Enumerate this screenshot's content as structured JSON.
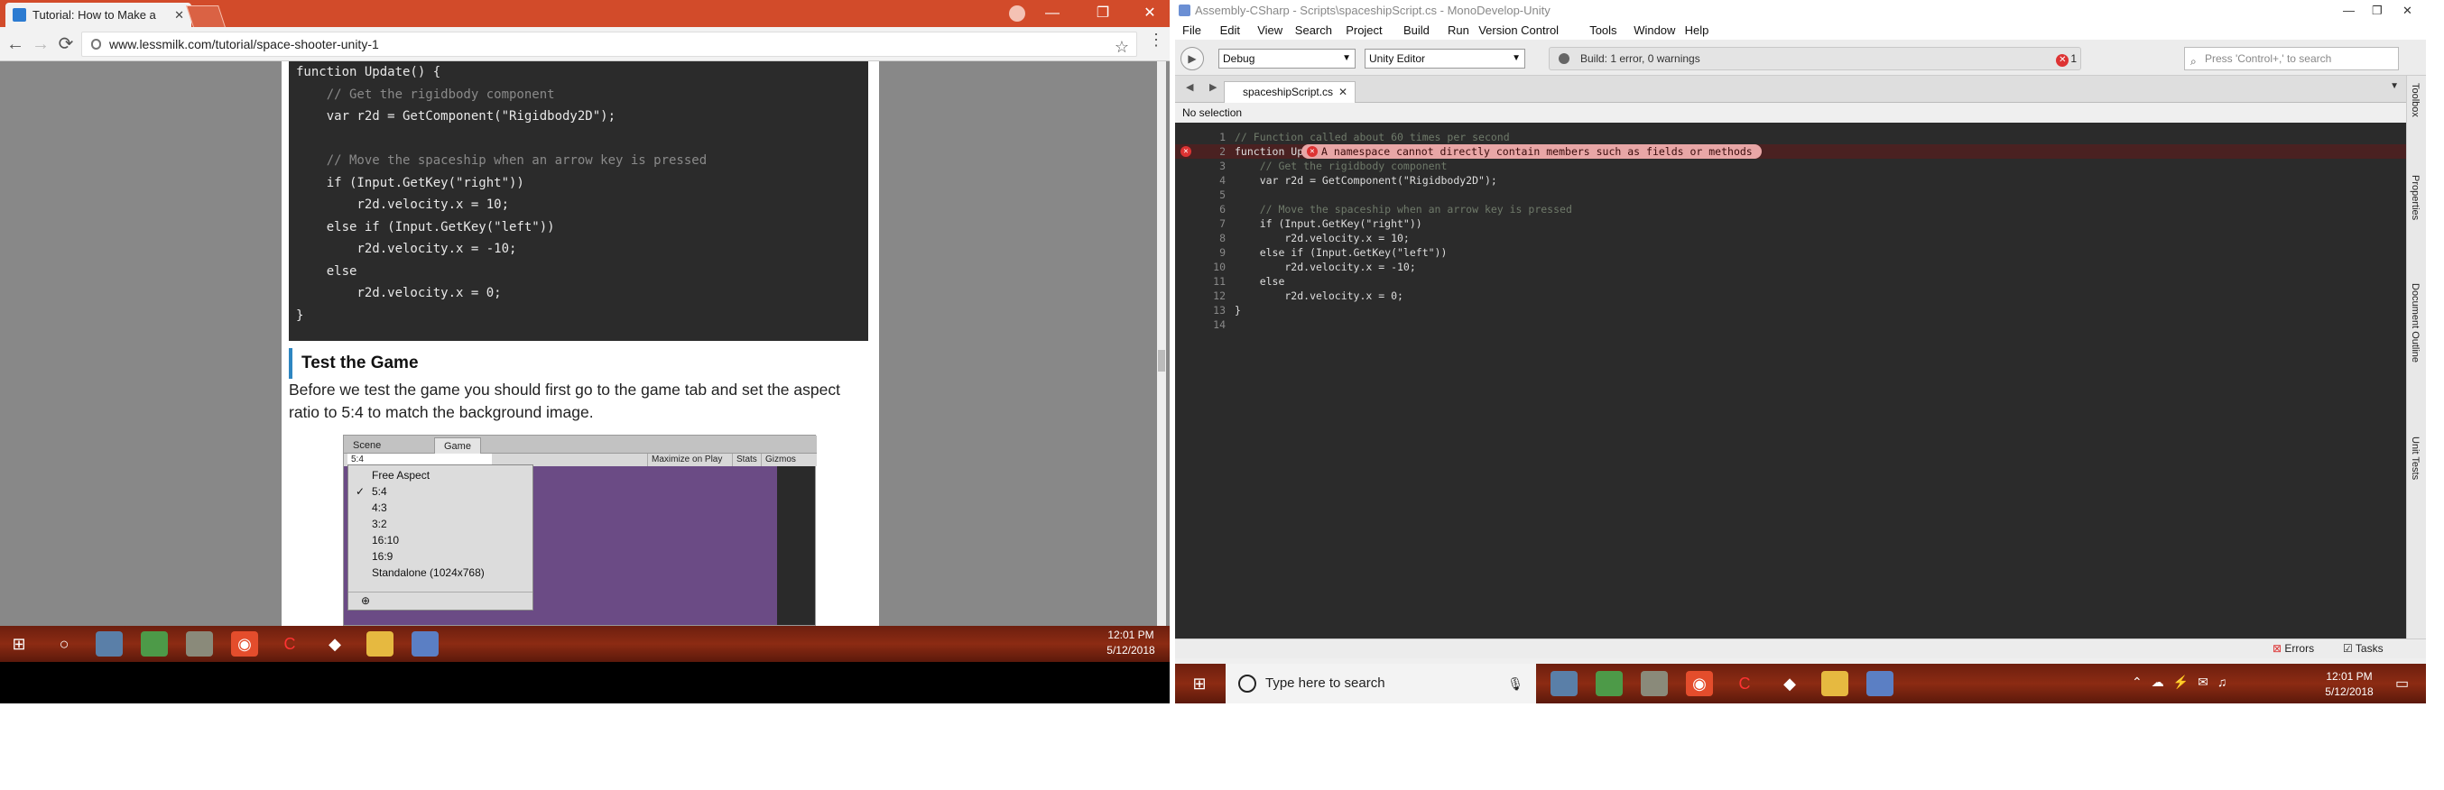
{
  "browser": {
    "tab_title": "Tutorial: How to Make a",
    "url": "www.lessmilk.com/tutorial/space-shooter-unity-1",
    "code_lines": [
      "function Update() {",
      "    // Get the rigidbody component",
      "    var r2d = GetComponent(\"Rigidbody2D\");",
      "",
      "    // Move the spaceship when an arrow key is pressed",
      "    if (Input.GetKey(\"right\"))",
      "        r2d.velocity.x = 10;",
      "    else if (Input.GetKey(\"left\"))",
      "        r2d.velocity.x = -10;",
      "    else",
      "        r2d.velocity.x = 0;",
      "}"
    ],
    "heading": "Test the Game",
    "paragraph": "Before we test the game you should first go to the game tab and set the aspect ratio to 5:4 to match the background image.",
    "unity": {
      "tab_scene": "Scene",
      "tab_game": "Game",
      "aspect_value": "5:4",
      "toolbar_buttons": [
        "Maximize on Play",
        "Stats",
        "Gizmos"
      ],
      "menu_items": [
        "Free Aspect",
        "5:4",
        "4:3",
        "3:2",
        "16:10",
        "16:9",
        "Standalone (1024x768)"
      ],
      "selected_item": "5:4"
    }
  },
  "taskbar_left": {
    "time": "12:01 PM",
    "date": "5/12/2018"
  },
  "ide": {
    "title": "Assembly-CSharp - Scripts\\spaceshipScript.cs - MonoDevelop-Unity",
    "menu": [
      "File",
      "Edit",
      "View",
      "Search",
      "Project",
      "Build",
      "Run",
      "Version Control",
      "Tools",
      "Window",
      "Help"
    ],
    "config": "Debug",
    "target": "Unity Editor",
    "build_status": "Build: 1 error, 0 warnings",
    "error_count": "1",
    "search_placeholder": "Press 'Control+,' to search",
    "doc_tab": "spaceshipScript.cs",
    "selection": "No selection",
    "line_numbers": [
      "1",
      "2",
      "3",
      "4",
      "5",
      "6",
      "7",
      "8",
      "9",
      "10",
      "11",
      "12",
      "13",
      "14"
    ],
    "code_lines": [
      "// Function called about 60 times per second",
      "function Update() {",
      "    // Get the rigidbody component",
      "    var r2d = GetComponent(\"Rigidbody2D\");",
      "",
      "    // Move the spaceship when an arrow key is pressed",
      "    if (Input.GetKey(\"right\"))",
      "        r2d.velocity.x = 10;",
      "    else if (Input.GetKey(\"left\"))",
      "        r2d.velocity.x = -10;",
      "    else",
      "        r2d.velocity.x = 0;",
      "}",
      ""
    ],
    "error_message": "A namespace cannot directly contain members such as fields or methods",
    "side_panels": [
      "Toolbox",
      "Properties",
      "Document Outline",
      "Unit Tests"
    ],
    "bottom_errors": "Errors",
    "bottom_tasks": "Tasks"
  },
  "taskbar_right": {
    "search_placeholder": "Type here to search",
    "time": "12:01 PM",
    "date": "5/12/2018"
  }
}
